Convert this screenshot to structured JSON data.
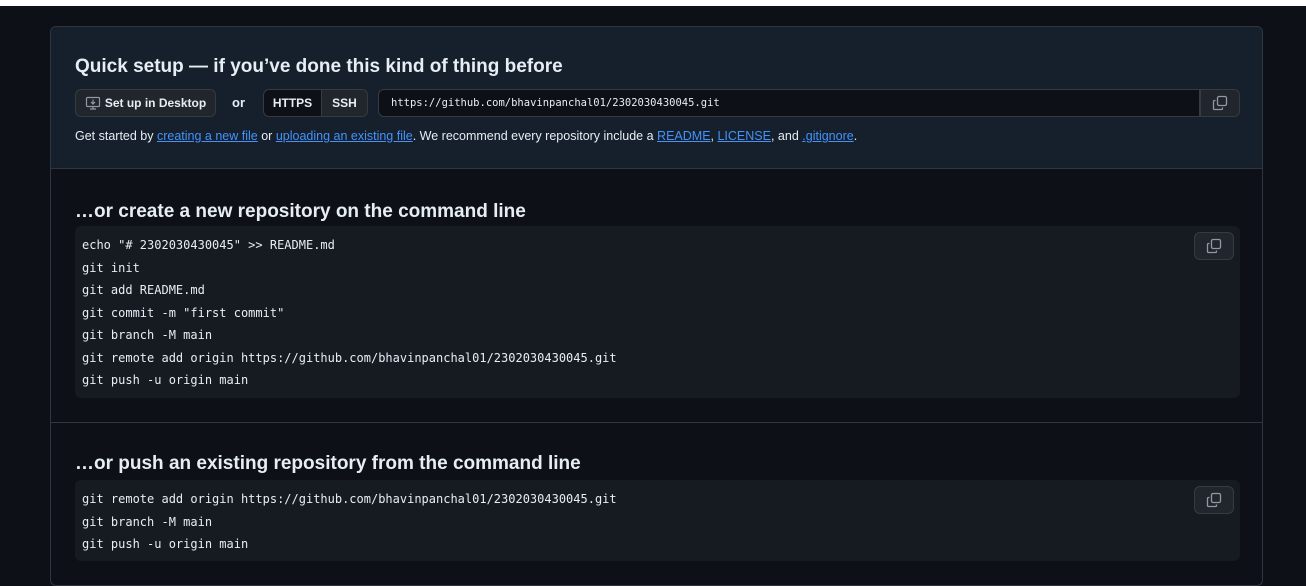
{
  "quick_setup": {
    "title": "Quick setup — if you’ve done this kind of thing before",
    "desktop_button": "Set up in Desktop",
    "or_text": "or",
    "protocols": [
      "HTTPS",
      "SSH"
    ],
    "clone_url": "https://github.com/bhavinpanchal01/2302030430045.git",
    "intro": {
      "t1": "Get started by ",
      "link1": "creating a new file",
      "t2": " or ",
      "link2": "uploading an existing file",
      "t3": ". We recommend every repository include a ",
      "link3": "README",
      "t4": ", ",
      "link4": "LICENSE",
      "t5": ", and ",
      "link5": ".gitignore",
      "t6": "."
    }
  },
  "new_repo": {
    "title": "…or create a new repository on the command line",
    "lines": [
      "echo \"# 2302030430045\" >> README.md",
      "git init",
      "git add README.md",
      "git commit -m \"first commit\"",
      "git branch -M main",
      "git remote add origin https://github.com/bhavinpanchal01/2302030430045.git",
      "git push -u origin main"
    ]
  },
  "push_existing": {
    "title": "…or push an existing repository from the command line",
    "lines": [
      "git remote add origin https://github.com/bhavinpanchal01/2302030430045.git",
      "git branch -M main",
      "git push -u origin main"
    ]
  },
  "icons": {
    "desktop": "desktop-download-icon",
    "copy": "copy-icon"
  },
  "colors": {
    "background": "#0d1117",
    "quick_setup_bg": "#161f2c",
    "code_bg": "#161b22",
    "link": "#4493f8",
    "border": "#30363d"
  }
}
